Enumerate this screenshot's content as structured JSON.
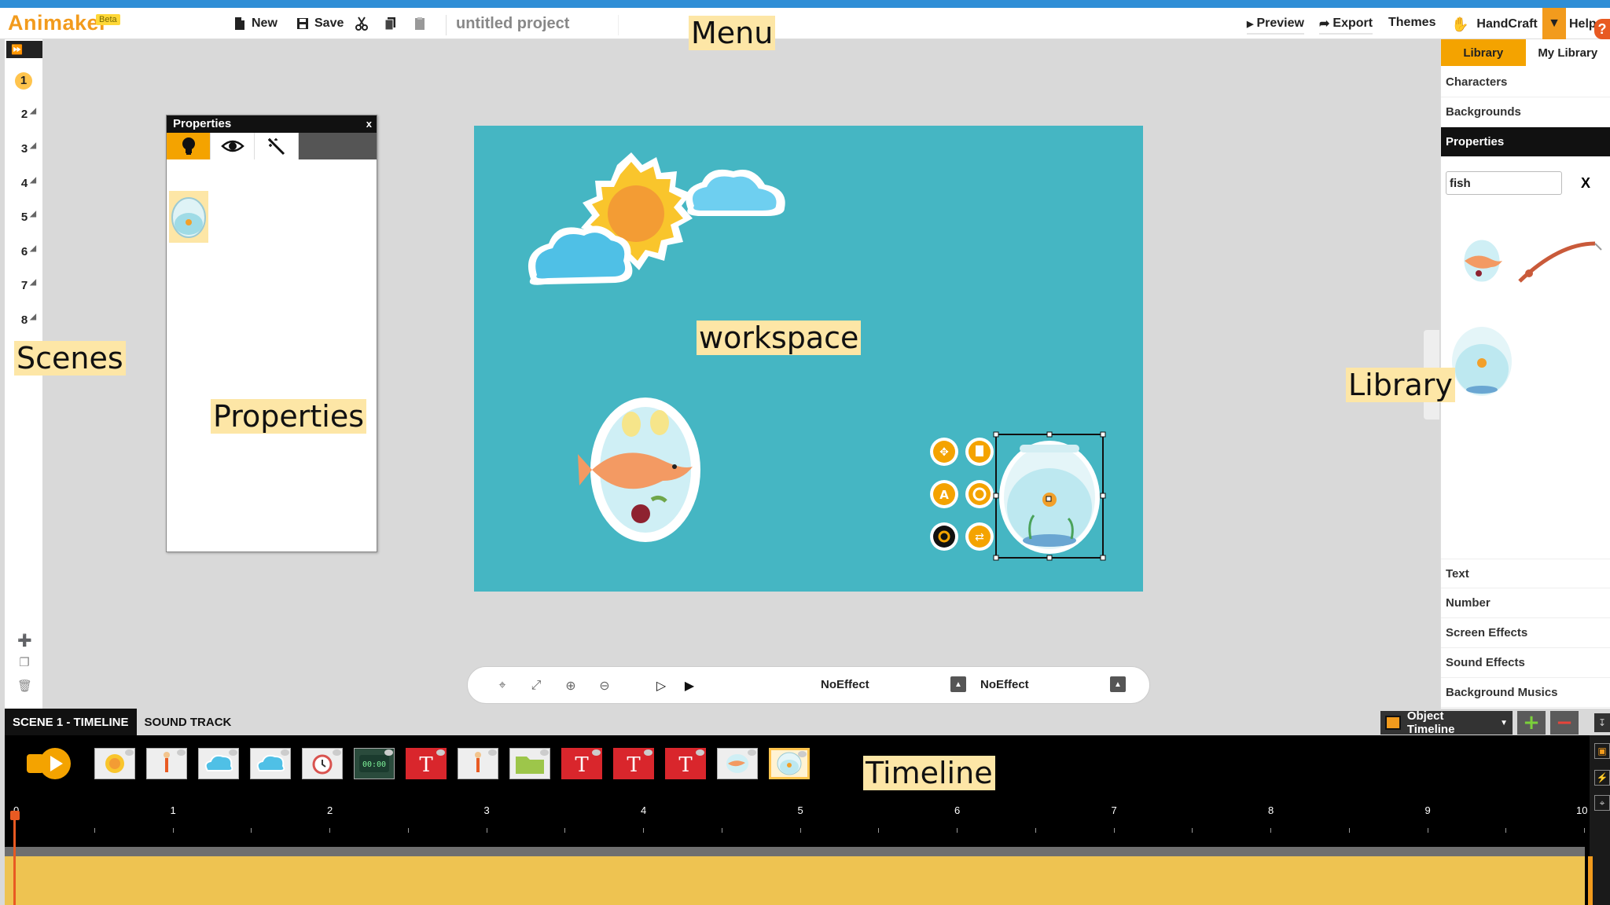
{
  "app": {
    "logo": "Animaker",
    "beta_badge": "Beta",
    "project_title": "untitled project"
  },
  "menu": {
    "new_label": "New",
    "save_label": "Save",
    "preview_label": "Preview",
    "export_label": "Export",
    "themes_label": "Themes",
    "handcraft_label": "HandCraft",
    "help_label": "Help"
  },
  "annotations": {
    "menu": "Menu",
    "scenes": "Scenes",
    "properties": "Properties",
    "workspace": "workspace",
    "library": "Library",
    "timeline": "Timeline"
  },
  "scenes": {
    "items": [
      "1",
      "2",
      "3",
      "4",
      "5",
      "6",
      "7",
      "8"
    ],
    "active_index": 0
  },
  "properties_panel": {
    "title": "Properties",
    "close_label": "x",
    "tabs": [
      {
        "icon": "bulb-icon",
        "active": true
      },
      {
        "icon": "eye-icon",
        "active": false
      },
      {
        "icon": "magic-wand-icon",
        "active": false
      }
    ]
  },
  "stage_toolbar": {
    "enter_effect": "NoEffect",
    "exit_effect": "NoEffect"
  },
  "library": {
    "tabs": [
      "Library",
      "My Library"
    ],
    "active_tab": 0,
    "categories_top": [
      "Characters",
      "Backgrounds",
      "Properties"
    ],
    "active_category": "Properties",
    "search_value": "fish",
    "clear_label": "X",
    "categories_bottom": [
      "Text",
      "Number",
      "Screen Effects",
      "Sound Effects",
      "Background Musics"
    ]
  },
  "timeline": {
    "tab_scene": "SCENE 1 - TIMELINE",
    "tab_sound": "SOUND TRACK",
    "mode_dropdown": "Object Timeline",
    "objects": [
      "sun",
      "character",
      "cloud",
      "cloud",
      "alarm-clock",
      "digital-clock",
      "text",
      "character",
      "folder",
      "text",
      "text",
      "text",
      "fish-plate",
      "fishbowl"
    ],
    "selected_object_index": 13,
    "ruler_labels": [
      "0",
      "1",
      "2",
      "3",
      "4",
      "5",
      "6",
      "7",
      "8",
      "9",
      "10"
    ],
    "playhead_position": "0"
  },
  "colors": {
    "accent": "#f4a300",
    "stage_bg": "#45b6c3",
    "top_stripe": "#2f8ed6",
    "timeline_track": "#eec351"
  }
}
